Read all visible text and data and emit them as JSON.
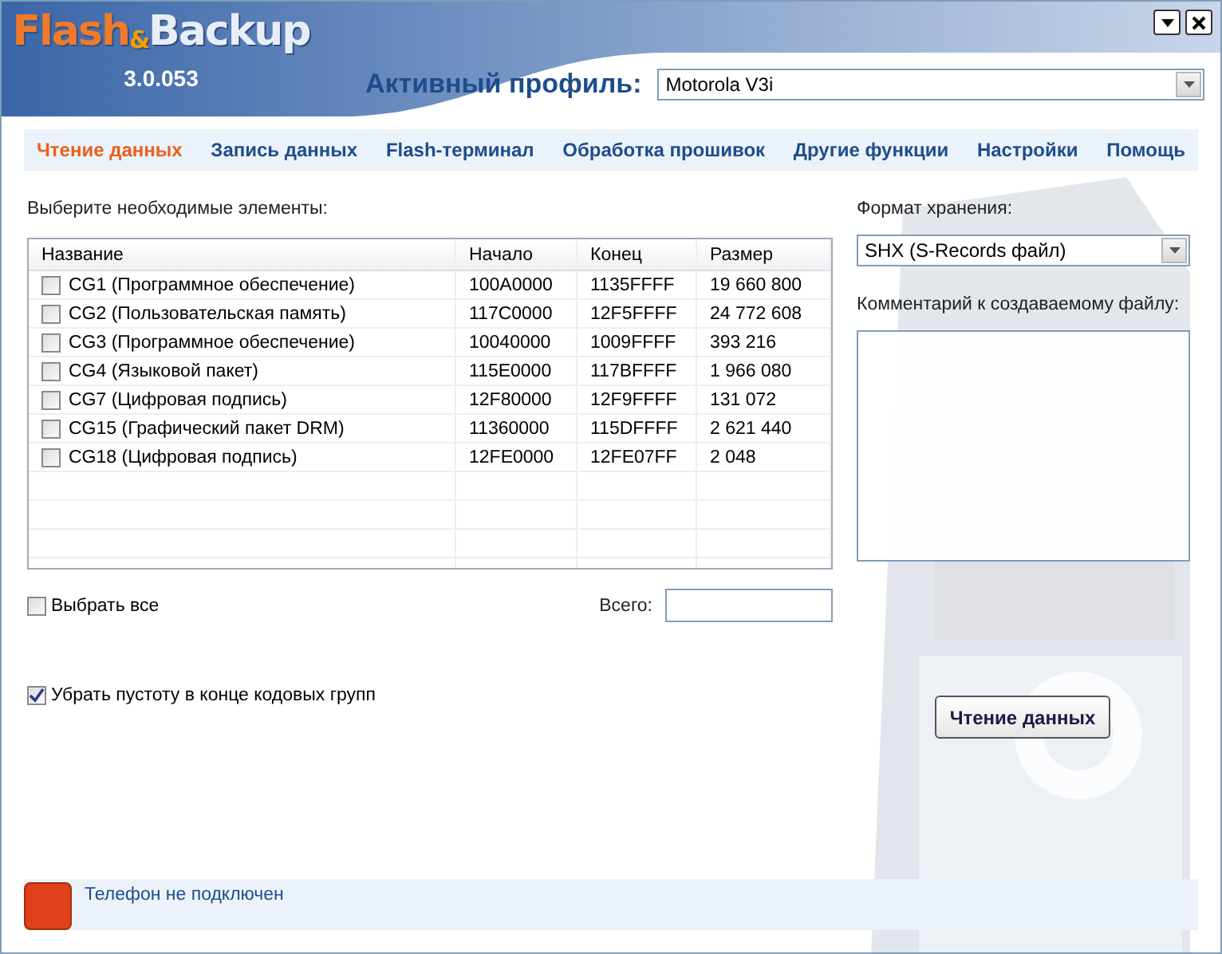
{
  "logo": {
    "parts": [
      "Flash",
      "&",
      "Backup"
    ],
    "version": "3.0.053"
  },
  "window_buttons": [
    {
      "kind": "minimize"
    },
    {
      "kind": "close"
    }
  ],
  "profile": {
    "label": "Активный профиль:",
    "value": "Motorola V3i"
  },
  "tabs": [
    {
      "label": "Чтение данных",
      "selected": true
    },
    {
      "label": "Запись данных",
      "selected": false
    },
    {
      "label": "Flash-терминал",
      "selected": false
    },
    {
      "label": "Обработка прошивок",
      "selected": false
    },
    {
      "label": "Другие функции",
      "selected": false
    },
    {
      "label": "Настройки",
      "selected": false
    },
    {
      "label": "Помощь",
      "selected": false
    }
  ],
  "elements_label": "Выберите необходимые элементы:",
  "table": {
    "columns": [
      "Название",
      "Начало",
      "Конец",
      "Размер"
    ],
    "rows": [
      {
        "checked": false,
        "cells": [
          "CG1 (Программное обеспечение)",
          "100A0000",
          "1135FFFF",
          "19 660 800"
        ]
      },
      {
        "checked": false,
        "cells": [
          "CG2 (Пользовательская память)",
          "117C0000",
          "12F5FFFF",
          "24 772 608"
        ]
      },
      {
        "checked": false,
        "cells": [
          "CG3 (Программное обеспечение)",
          "10040000",
          "1009FFFF",
          "393 216"
        ]
      },
      {
        "checked": false,
        "cells": [
          "CG4 (Языковой пакет)",
          "115E0000",
          "117BFFFF",
          "1 966 080"
        ]
      },
      {
        "checked": false,
        "cells": [
          "CG7 (Цифровая подпись)",
          "12F80000",
          "12F9FFFF",
          "131 072"
        ]
      },
      {
        "checked": false,
        "cells": [
          "CG15 (Графический пакет DRM)",
          "11360000",
          "115DFFFF",
          "2 621 440"
        ]
      },
      {
        "checked": false,
        "cells": [
          "CG18 (Цифровая подпись)",
          "12FE0000",
          "12FE07FF",
          "2 048"
        ]
      }
    ]
  },
  "select_all": {
    "label": "Выбрать все",
    "checked": false
  },
  "total": {
    "label": "Всего:"
  },
  "trim": {
    "label": "Убрать пустоту в конце кодовых групп",
    "checked": true
  },
  "format": {
    "label": "Формат хранения:",
    "value": "SHX (S-Records файл)"
  },
  "comment": {
    "label": "Комментарий к создаваемому файлу:"
  },
  "action_button": "Чтение данных",
  "status": {
    "text": "Телефон не подключен",
    "connected": false
  }
}
